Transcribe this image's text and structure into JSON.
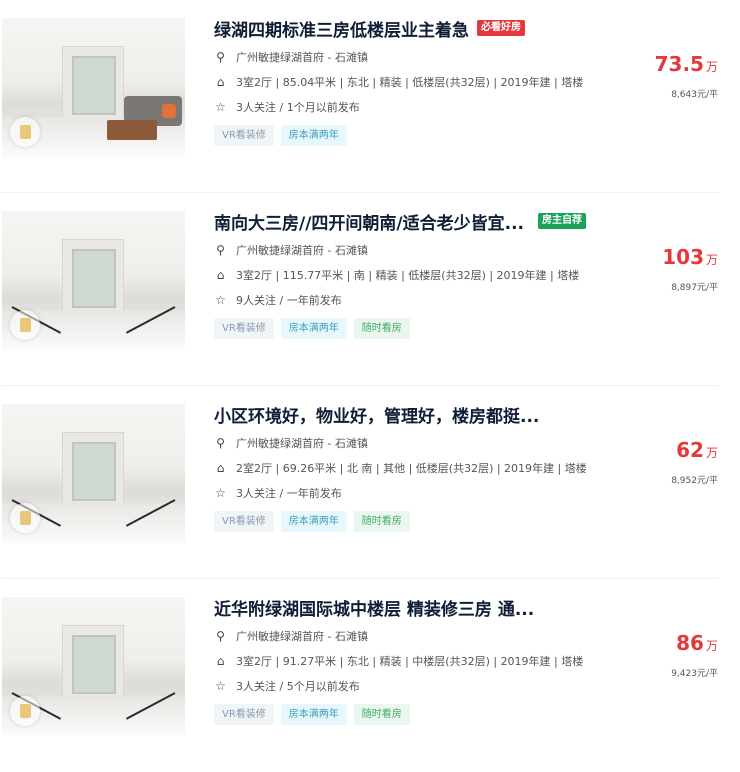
{
  "colors": {
    "price": "#e4393c",
    "hot_tag": "#e4393c",
    "owner_tag": "#1aa35a"
  },
  "listings": [
    {
      "title": "绿湖四期标准三房低楼层业主着急",
      "tag": "必看好房",
      "tag_color": "#e4393c",
      "location": "广州敏捷绿湖首府 - 石滩镇",
      "specs": "3室2厅 | 85.04平米 | 东北 | 精装 | 低楼层(共32层) | 2019年建 | 塔楼",
      "follow": "3人关注 / 1个月以前发布",
      "chips": [
        "VR看装修",
        "房本满两年"
      ],
      "price": "73.5",
      "price_unit": "万",
      "unit_price": "8,643元/平"
    },
    {
      "title": "南向大三房//四开间朝南/适合老少皆宜...",
      "tag": "房主自荐",
      "tag_color": "#1aa35a",
      "location": "广州敏捷绿湖首府 - 石滩镇",
      "specs": "3室2厅 | 115.77平米 | 南 | 精装 | 低楼层(共32层) | 2019年建 | 塔楼",
      "follow": "9人关注 / 一年前发布",
      "chips": [
        "VR看装修",
        "房本满两年",
        "随时看房"
      ],
      "price": "103",
      "price_unit": "万",
      "unit_price": "8,897元/平"
    },
    {
      "title": "小区环境好，物业好，管理好，楼房都挺...",
      "tag": "",
      "tag_color": "",
      "location": "广州敏捷绿湖首府 - 石滩镇",
      "specs": "2室2厅 | 69.26平米 | 北 南 | 其他 | 低楼层(共32层) | 2019年建 | 塔楼",
      "follow": "3人关注 / 一年前发布",
      "chips": [
        "VR看装修",
        "房本满两年",
        "随时看房"
      ],
      "price": "62",
      "price_unit": "万",
      "unit_price": "8,952元/平"
    },
    {
      "title": "近华附绿湖国际城中楼层 精装修三房 通...",
      "tag": "",
      "tag_color": "",
      "location": "广州敏捷绿湖首府 - 石滩镇",
      "specs": "3室2厅 | 91.27平米 | 东北 | 精装 | 中楼层(共32层) | 2019年建 | 塔楼",
      "follow": "3人关注 / 5个月以前发布",
      "chips": [
        "VR看装修",
        "房本满两年",
        "随时看房"
      ],
      "price": "86",
      "price_unit": "万",
      "unit_price": "9,423元/平"
    }
  ]
}
